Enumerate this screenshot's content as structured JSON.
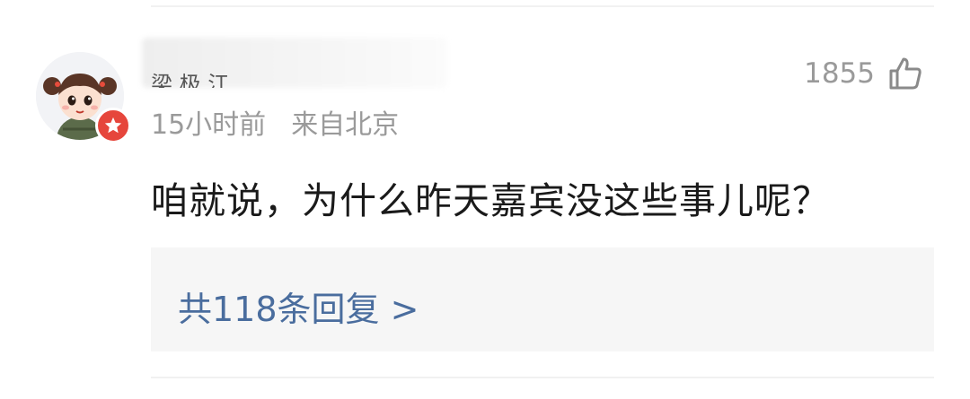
{
  "comment": {
    "username": "梁 极 江",
    "time": "15小时前",
    "location": "来自北京",
    "like_count": "1855",
    "text": "咱就说，为什么昨天嘉宾没这些事儿呢？",
    "replies_label": "共118条回复 >"
  },
  "icons": {
    "avatar": "cartoon-girl-avatar",
    "badge": "verified-star-badge",
    "like": "thumbs-up-icon"
  },
  "colors": {
    "badge_red": "#e6463c",
    "link_blue": "#4a6d9e",
    "meta_gray": "#9a9a9a"
  }
}
